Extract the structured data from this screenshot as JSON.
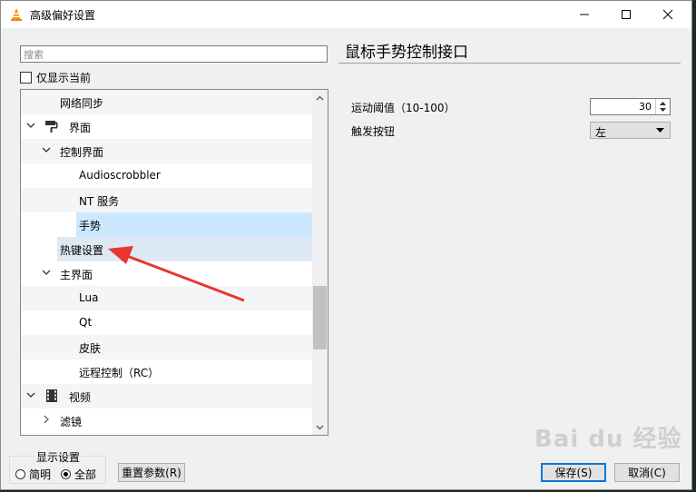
{
  "window": {
    "title": "高级偏好设置"
  },
  "search": {
    "placeholder": "搜索"
  },
  "filter": {
    "label": "仅显示当前"
  },
  "tree": {
    "items": [
      {
        "label": "网络同步"
      },
      {
        "label": "界面"
      },
      {
        "label": "控制界面"
      },
      {
        "label": "Audioscrobbler"
      },
      {
        "label": "NT 服务"
      },
      {
        "label": "手势"
      },
      {
        "label": "热键设置"
      },
      {
        "label": "主界面"
      },
      {
        "label": "Lua"
      },
      {
        "label": "Qt"
      },
      {
        "label": "皮肤"
      },
      {
        "label": "远程控制（RC）"
      },
      {
        "label": "视频"
      },
      {
        "label": "滤镜"
      }
    ]
  },
  "panel": {
    "title": "鼠标手势控制接口",
    "threshold_label": "运动阈值（10-100）",
    "threshold_value": "30",
    "trigger_label": "触发按钮",
    "trigger_value": "左"
  },
  "display_settings": {
    "title": "显示设置",
    "simple_label": "简明",
    "all_label": "全部",
    "selected": "全部"
  },
  "buttons": {
    "reset": "重置参数(R)",
    "save": "保存(S)",
    "cancel": "取消(C)"
  },
  "colors": {
    "selection": "#cce8ff",
    "annotation_arrow": "#e8362f"
  }
}
